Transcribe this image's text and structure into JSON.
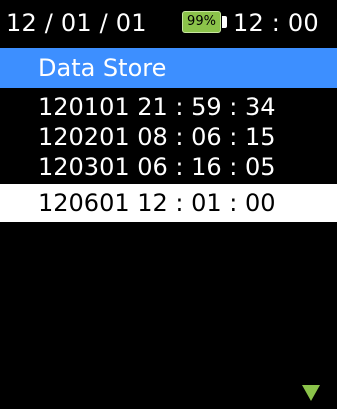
{
  "status": {
    "date": "12 / 01 / 01",
    "battery": "99%",
    "time": "12 : 00",
    "battery_color": "#8bc34a"
  },
  "title": "Data Store",
  "records": [
    "120101  21 : 59 : 34",
    "120201  08 : 06 : 15",
    "120301  06 : 16 : 05",
    "120601  12 : 01 : 00"
  ],
  "selected_index": 3,
  "colors": {
    "background": "#000000",
    "title_bar": "#3d8fff",
    "selection": "#ffffff",
    "text": "#ffffff"
  },
  "icons": {
    "scroll_down": "triangle-down-icon"
  }
}
